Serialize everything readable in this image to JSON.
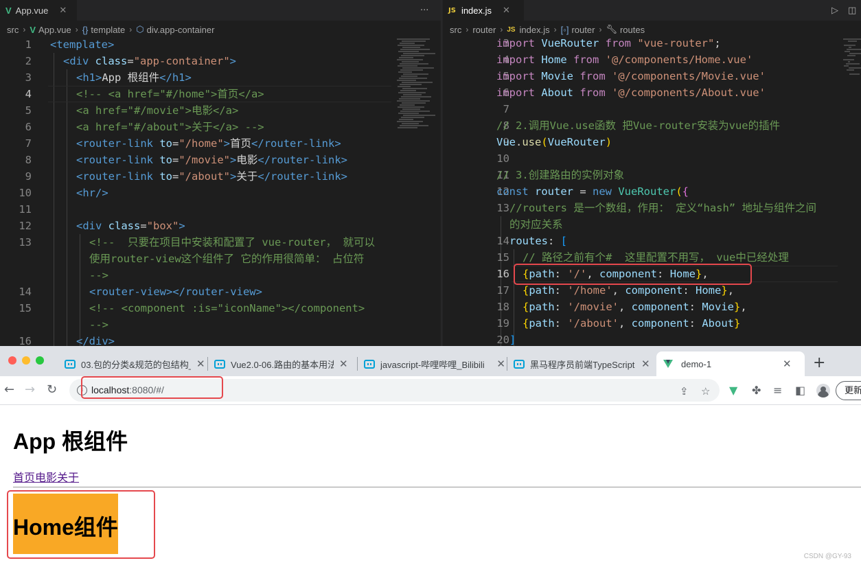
{
  "left_editor": {
    "tab": {
      "label": "App.vue",
      "icon": "vue-icon",
      "close": "✕"
    },
    "more": "···",
    "breadcrumb": {
      "folder": "src",
      "file": "App.vue",
      "section": "template",
      "element": "div.app-container"
    },
    "lines": [
      {
        "no": "1",
        "parts": [
          [
            "tag",
            "<template>"
          ]
        ]
      },
      {
        "no": "2",
        "parts": [
          [
            "tag",
            "<div "
          ],
          [
            "attr",
            "class"
          ],
          [
            "txt",
            "="
          ],
          [
            "str",
            "\"app-container\""
          ],
          [
            "tag",
            ">"
          ]
        ]
      },
      {
        "no": "3",
        "parts": [
          [
            "tag",
            "<h1>"
          ],
          [
            "txt",
            "App 根组件"
          ],
          [
            "tag",
            "</h1>"
          ]
        ]
      },
      {
        "no": "4",
        "parts": [
          [
            "com",
            "<!-- <a href=\"#/home\">首页</a>"
          ]
        ]
      },
      {
        "no": "5",
        "parts": [
          [
            "com",
            "<a href=\"#/movie\">电影</a>"
          ]
        ]
      },
      {
        "no": "6",
        "parts": [
          [
            "com",
            "<a href=\"#/about\">关于</a> -->"
          ]
        ]
      },
      {
        "no": "7",
        "parts": [
          [
            "tag",
            "<router-link "
          ],
          [
            "attr",
            "to"
          ],
          [
            "txt",
            "="
          ],
          [
            "str",
            "\"/home\""
          ],
          [
            "tag",
            ">"
          ],
          [
            "txt",
            "首页"
          ],
          [
            "tag",
            "</router-link>"
          ]
        ]
      },
      {
        "no": "8",
        "parts": [
          [
            "tag",
            "<router-link "
          ],
          [
            "attr",
            "to"
          ],
          [
            "txt",
            "="
          ],
          [
            "str",
            "\"/movie\""
          ],
          [
            "tag",
            ">"
          ],
          [
            "txt",
            "电影"
          ],
          [
            "tag",
            "</router-link>"
          ]
        ]
      },
      {
        "no": "9",
        "parts": [
          [
            "tag",
            "<router-link "
          ],
          [
            "attr",
            "to"
          ],
          [
            "txt",
            "="
          ],
          [
            "str",
            "\"/about\""
          ],
          [
            "tag",
            ">"
          ],
          [
            "txt",
            "关于"
          ],
          [
            "tag",
            "</router-link>"
          ]
        ]
      },
      {
        "no": "10",
        "parts": [
          [
            "tag",
            "<hr/>"
          ]
        ]
      },
      {
        "no": "11",
        "parts": []
      },
      {
        "no": "12",
        "parts": [
          [
            "tag",
            "<div "
          ],
          [
            "attr",
            "class"
          ],
          [
            "txt",
            "="
          ],
          [
            "str",
            "\"box\""
          ],
          [
            "tag",
            ">"
          ]
        ]
      },
      {
        "no": "13",
        "parts": [
          [
            "com",
            "<!--  只要在项目中安装和配置了 vue-router， 就可以"
          ]
        ]
      },
      {
        "no": "",
        "parts": [
          [
            "com",
            "使用router-view这个组件了 它的作用很简单： 占位符"
          ]
        ]
      },
      {
        "no": "",
        "parts": [
          [
            "com",
            "-->"
          ]
        ]
      },
      {
        "no": "14",
        "parts": [
          [
            "tag",
            "<router-view></router-view>"
          ]
        ]
      },
      {
        "no": "15",
        "parts": [
          [
            "com",
            "<!-- <component :is=\"iconName\"></component>"
          ]
        ]
      },
      {
        "no": "",
        "parts": [
          [
            "com",
            "-->"
          ]
        ]
      },
      {
        "no": "16",
        "parts": [
          [
            "tag",
            "</div>"
          ]
        ]
      }
    ]
  },
  "right_editor": {
    "tab": {
      "label": "index.js",
      "icon": "JS",
      "close": "✕"
    },
    "actions": {
      "run": "▷",
      "split": "◫"
    },
    "breadcrumb": {
      "folder1": "src",
      "folder2": "router",
      "file": "index.js",
      "symbol1": "router",
      "symbol2": "routes"
    },
    "lines": [
      {
        "no": "3",
        "parts": [
          [
            "kw",
            "import "
          ],
          [
            "var",
            "VueRouter "
          ],
          [
            "kw",
            "from "
          ],
          [
            "str",
            "\"vue-router\""
          ],
          [
            "txt",
            ";"
          ]
        ]
      },
      {
        "no": "4",
        "parts": [
          [
            "kw",
            "import "
          ],
          [
            "var",
            "Home "
          ],
          [
            "kw",
            "from "
          ],
          [
            "str",
            "'@/components/Home.vue'"
          ]
        ]
      },
      {
        "no": "5",
        "parts": [
          [
            "kw",
            "import "
          ],
          [
            "var",
            "Movie "
          ],
          [
            "kw",
            "from "
          ],
          [
            "str",
            "'@/components/Movie.vue'"
          ]
        ]
      },
      {
        "no": "6",
        "parts": [
          [
            "kw",
            "import "
          ],
          [
            "var",
            "About "
          ],
          [
            "kw",
            "from "
          ],
          [
            "str",
            "'@/components/About.vue'"
          ]
        ]
      },
      {
        "no": "7",
        "parts": []
      },
      {
        "no": "8",
        "parts": [
          [
            "com",
            "// 2.调用Vue.use函数 把Vue-router安装为vue的插件"
          ]
        ]
      },
      {
        "no": "9",
        "parts": [
          [
            "var",
            "Vue"
          ],
          [
            "txt",
            "."
          ],
          [
            "fn",
            "use"
          ],
          [
            "br",
            "("
          ],
          [
            "var",
            "VueRouter"
          ],
          [
            "br",
            ")"
          ]
        ]
      },
      {
        "no": "10",
        "parts": []
      },
      {
        "no": "11",
        "parts": [
          [
            "com",
            "// 3.创建路由的实例对象"
          ]
        ]
      },
      {
        "no": "12",
        "parts": [
          [
            "kw2",
            "const "
          ],
          [
            "var",
            "router "
          ],
          [
            "txt",
            "= "
          ],
          [
            "kw2",
            "new "
          ],
          [
            "cls",
            "VueRouter"
          ],
          [
            "br",
            "("
          ],
          [
            "br2",
            "{"
          ]
        ]
      },
      {
        "no": "13",
        "parts": [
          [
            "com",
            "//routers 是一个数组，作用： 定义“hash” 地址与组件之间"
          ]
        ]
      },
      {
        "no": "",
        "parts": [
          [
            "com",
            "的对应关系"
          ]
        ]
      },
      {
        "no": "14",
        "parts": [
          [
            "var",
            "routes"
          ],
          [
            "txt",
            ": "
          ],
          [
            "br3",
            "["
          ]
        ]
      },
      {
        "no": "15",
        "parts": [
          [
            "com",
            "// 路径之前有个#  这里配置不用写， vue中已经处理"
          ]
        ]
      },
      {
        "no": "16",
        "parts": [
          [
            "br",
            "{"
          ],
          [
            "var",
            "path"
          ],
          [
            "txt",
            ": "
          ],
          [
            "str",
            "'/'"
          ],
          [
            "txt",
            ", "
          ],
          [
            "var",
            "component"
          ],
          [
            "txt",
            ": "
          ],
          [
            "var",
            "Home"
          ],
          [
            "br",
            "}"
          ],
          [
            "txt",
            ","
          ]
        ]
      },
      {
        "no": "17",
        "parts": [
          [
            "br",
            "{"
          ],
          [
            "var",
            "path"
          ],
          [
            "txt",
            ": "
          ],
          [
            "str",
            "'/home'"
          ],
          [
            "txt",
            ", "
          ],
          [
            "var",
            "component"
          ],
          [
            "txt",
            ": "
          ],
          [
            "var",
            "Home"
          ],
          [
            "br",
            "}"
          ],
          [
            "txt",
            ","
          ]
        ]
      },
      {
        "no": "18",
        "parts": [
          [
            "br",
            "{"
          ],
          [
            "var",
            "path"
          ],
          [
            "txt",
            ": "
          ],
          [
            "str",
            "'/movie'"
          ],
          [
            "txt",
            ", "
          ],
          [
            "var",
            "component"
          ],
          [
            "txt",
            ": "
          ],
          [
            "var",
            "Movie"
          ],
          [
            "br",
            "}"
          ],
          [
            "txt",
            ","
          ]
        ]
      },
      {
        "no": "19",
        "parts": [
          [
            "br",
            "{"
          ],
          [
            "var",
            "path"
          ],
          [
            "txt",
            ": "
          ],
          [
            "str",
            "'/about'"
          ],
          [
            "txt",
            ", "
          ],
          [
            "var",
            "component"
          ],
          [
            "txt",
            ": "
          ],
          [
            "var",
            "About"
          ],
          [
            "br",
            "}"
          ]
        ]
      },
      {
        "no": "20",
        "parts": [
          [
            "br3",
            "]"
          ]
        ]
      }
    ]
  },
  "browser": {
    "tabs": [
      {
        "label": "03.包的分类&规范的包结构_",
        "close": "✕"
      },
      {
        "label": "Vue2.0-06.路由的基本用法",
        "close": "✕"
      },
      {
        "label": "javascript-哔哩哔哩_Bilibili",
        "close": "✕"
      },
      {
        "label": "黑马程序员前端TypeScript",
        "close": "✕"
      },
      {
        "label": "demo-1",
        "close": "✕"
      }
    ],
    "new_tab": "+",
    "nav": {
      "back": "←",
      "forward": "→",
      "reload": "↻"
    },
    "url": {
      "host": "localhost",
      "rest": ":8080/#/"
    },
    "update_label": "更新",
    "page": {
      "h1": "App 根组件",
      "links": [
        "首页",
        "电影",
        "关于"
      ],
      "component_title": "Home组件"
    }
  },
  "watermark": "CSDN @GY-93",
  "colors": {
    "highlight_border": "#e5484d",
    "home_box": "#f9a825",
    "vue_green": "#41b883"
  }
}
